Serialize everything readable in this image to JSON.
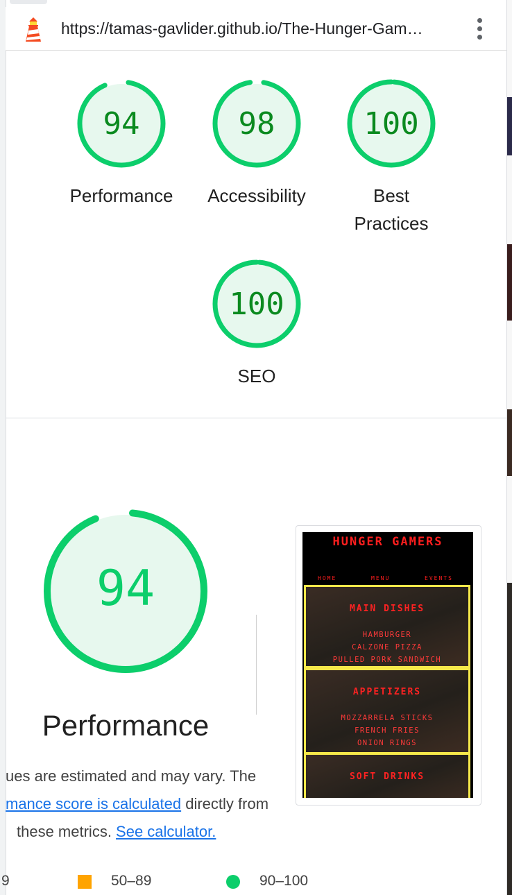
{
  "browser": {
    "url": "https://tamas-gavlider.github.io/The-Hunger-Gam…",
    "site_icon": "lighthouse-icon",
    "menu_icon": "more-vert-icon"
  },
  "scores": [
    {
      "label": "Performance",
      "value": "94",
      "fraction": 0.94
    },
    {
      "label": "Accessibility",
      "value": "98",
      "fraction": 0.98
    },
    {
      "label": "Best Practices",
      "value": "100",
      "fraction": 1.0
    },
    {
      "label": "SEO",
      "value": "100",
      "fraction": 1.0
    }
  ],
  "performance": {
    "score": "94",
    "fraction": 0.94,
    "title": "Performance",
    "desc_line1": "ues are estimated and may vary. The",
    "link1": "mance score is calculated",
    "desc_line2_rest": " directly from",
    "desc_line3": "these metrics. ",
    "link2": "See calculator.",
    "legend": {
      "fail_partial": "9",
      "average": "50–89",
      "pass": "90–100"
    }
  },
  "screenshot": {
    "title": "HUNGER GAMERS",
    "nav": [
      "HOME",
      "MENU",
      "EVENTS"
    ],
    "sections": [
      {
        "heading": "MAIN DISHES",
        "items": [
          "HAMBURGER",
          "CALZONE PIZZA",
          "PULLED PORK SANDWICH"
        ]
      },
      {
        "heading": "APPETIZERS",
        "items": [
          "MOZZARRELA STICKS",
          "FRENCH FRIES",
          "ONION RINGS"
        ]
      },
      {
        "heading": "SOFT DRINKS",
        "items": []
      }
    ]
  },
  "colors": {
    "pass": "#0cce6b",
    "pass_text": "#0b8a1f",
    "pass_fill": "#e7f8ee",
    "average": "#ffa400",
    "link": "#1a73e8"
  }
}
